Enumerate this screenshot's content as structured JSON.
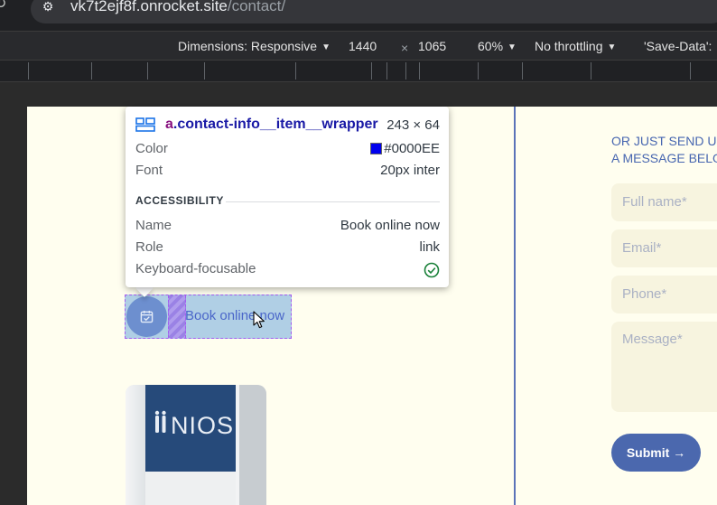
{
  "browser": {
    "url_host": "vk7t2ejf8f.onrocket.site",
    "url_path": "/contact/"
  },
  "devtools_toolbar": {
    "dimensions_label": "Dimensions: Responsive",
    "width": "1440",
    "times": "×",
    "height": "1065",
    "zoom": "60%",
    "throttling": "No throttling",
    "save_data": "'Save-Data':"
  },
  "inspector_tooltip": {
    "tag": "a",
    "class_name": ".contact-info__item__wrapper",
    "size": "243 × 64",
    "color_label": "Color",
    "color_value": "#0000EE",
    "font_label": "Font",
    "font_value": "20px inter",
    "section_title": "ACCESSIBILITY",
    "name_label": "Name",
    "name_value": "Book online now",
    "role_label": "Role",
    "role_value": "link",
    "focusable_label": "Keyboard-focusable"
  },
  "page": {
    "link_text": "Book online now",
    "form_heading": "OR JUST SEND U\nA MESSAGE BELO",
    "fields": [
      {
        "placeholder": "Full name*"
      },
      {
        "placeholder": "Email*"
      },
      {
        "placeholder": "Phone*"
      },
      {
        "placeholder": "Message*"
      }
    ],
    "submit_label": "Submit →",
    "photo_sign": "NIOS"
  },
  "colors": {
    "page_background": "#fffeef",
    "accent_blue": "#4b68ae",
    "link_color": "#0000EE",
    "highlight_border": "#a35cf1"
  },
  "icons": {
    "site_info": "tune-icon",
    "element_type": "grid-icon",
    "focusable": "check-circle-icon",
    "link_icon": "calendar-check-icon"
  }
}
